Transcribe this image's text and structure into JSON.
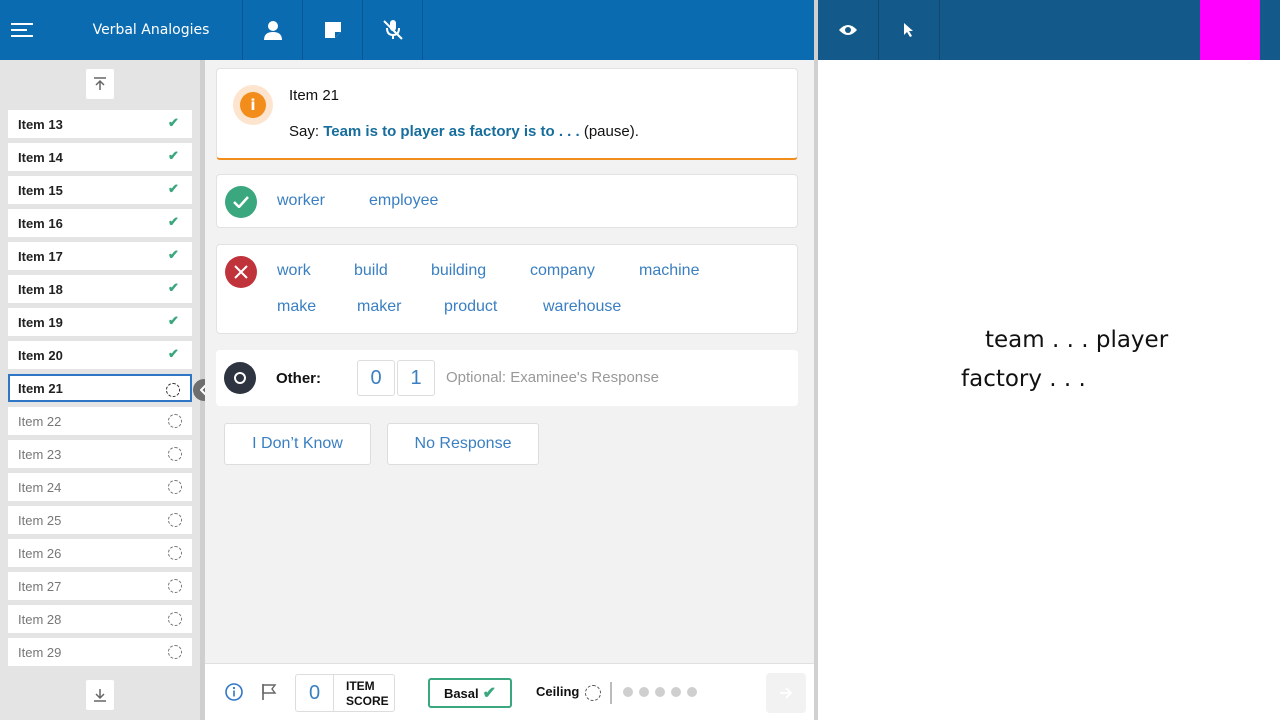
{
  "header": {
    "title": "Verbal Analogies"
  },
  "sidebar": {
    "items": [
      {
        "label": "Item 13",
        "state": "done"
      },
      {
        "label": "Item 14",
        "state": "done"
      },
      {
        "label": "Item 15",
        "state": "done"
      },
      {
        "label": "Item 16",
        "state": "done"
      },
      {
        "label": "Item 17",
        "state": "done"
      },
      {
        "label": "Item 18",
        "state": "done"
      },
      {
        "label": "Item 19",
        "state": "done"
      },
      {
        "label": "Item 20",
        "state": "done"
      },
      {
        "label": "Item 21",
        "state": "current"
      },
      {
        "label": "Item 22",
        "state": "todo"
      },
      {
        "label": "Item 23",
        "state": "todo"
      },
      {
        "label": "Item 24",
        "state": "todo"
      },
      {
        "label": "Item 25",
        "state": "todo"
      },
      {
        "label": "Item 26",
        "state": "todo"
      },
      {
        "label": "Item 27",
        "state": "todo"
      },
      {
        "label": "Item 28",
        "state": "todo"
      },
      {
        "label": "Item 29",
        "state": "todo"
      }
    ]
  },
  "question": {
    "title": "Item 21",
    "say_prefix": "Say:",
    "prompt": "Team is to player as factory is to . . .",
    "suffix": "(pause)."
  },
  "responses": {
    "correct": [
      "worker",
      "employee"
    ],
    "incorrect": [
      "work",
      "build",
      "building",
      "company",
      "machine",
      "make",
      "maker",
      "product",
      "warehouse"
    ]
  },
  "other": {
    "label": "Other:",
    "score_0": "0",
    "score_1": "1",
    "placeholder": "Optional: Examinee's Response"
  },
  "actions": {
    "dont_know": "I Don’t Know",
    "no_response": "No Response"
  },
  "footer": {
    "item_score_value": "0",
    "item_score_label_1": "ITEM",
    "item_score_label_2": "SCORE",
    "basal_label": "Basal",
    "ceiling_label": "Ceiling"
  },
  "stimulus": {
    "line1": "team . . . player",
    "line2": "factory . . ."
  },
  "colors": {
    "header": "#0b6bb0",
    "header_right": "#135a8a",
    "accent": "#3a7fc1",
    "correct": "#3aa77e",
    "incorrect": "#c0333b",
    "info": "#f28c1b",
    "marker": "#ff00ff"
  }
}
